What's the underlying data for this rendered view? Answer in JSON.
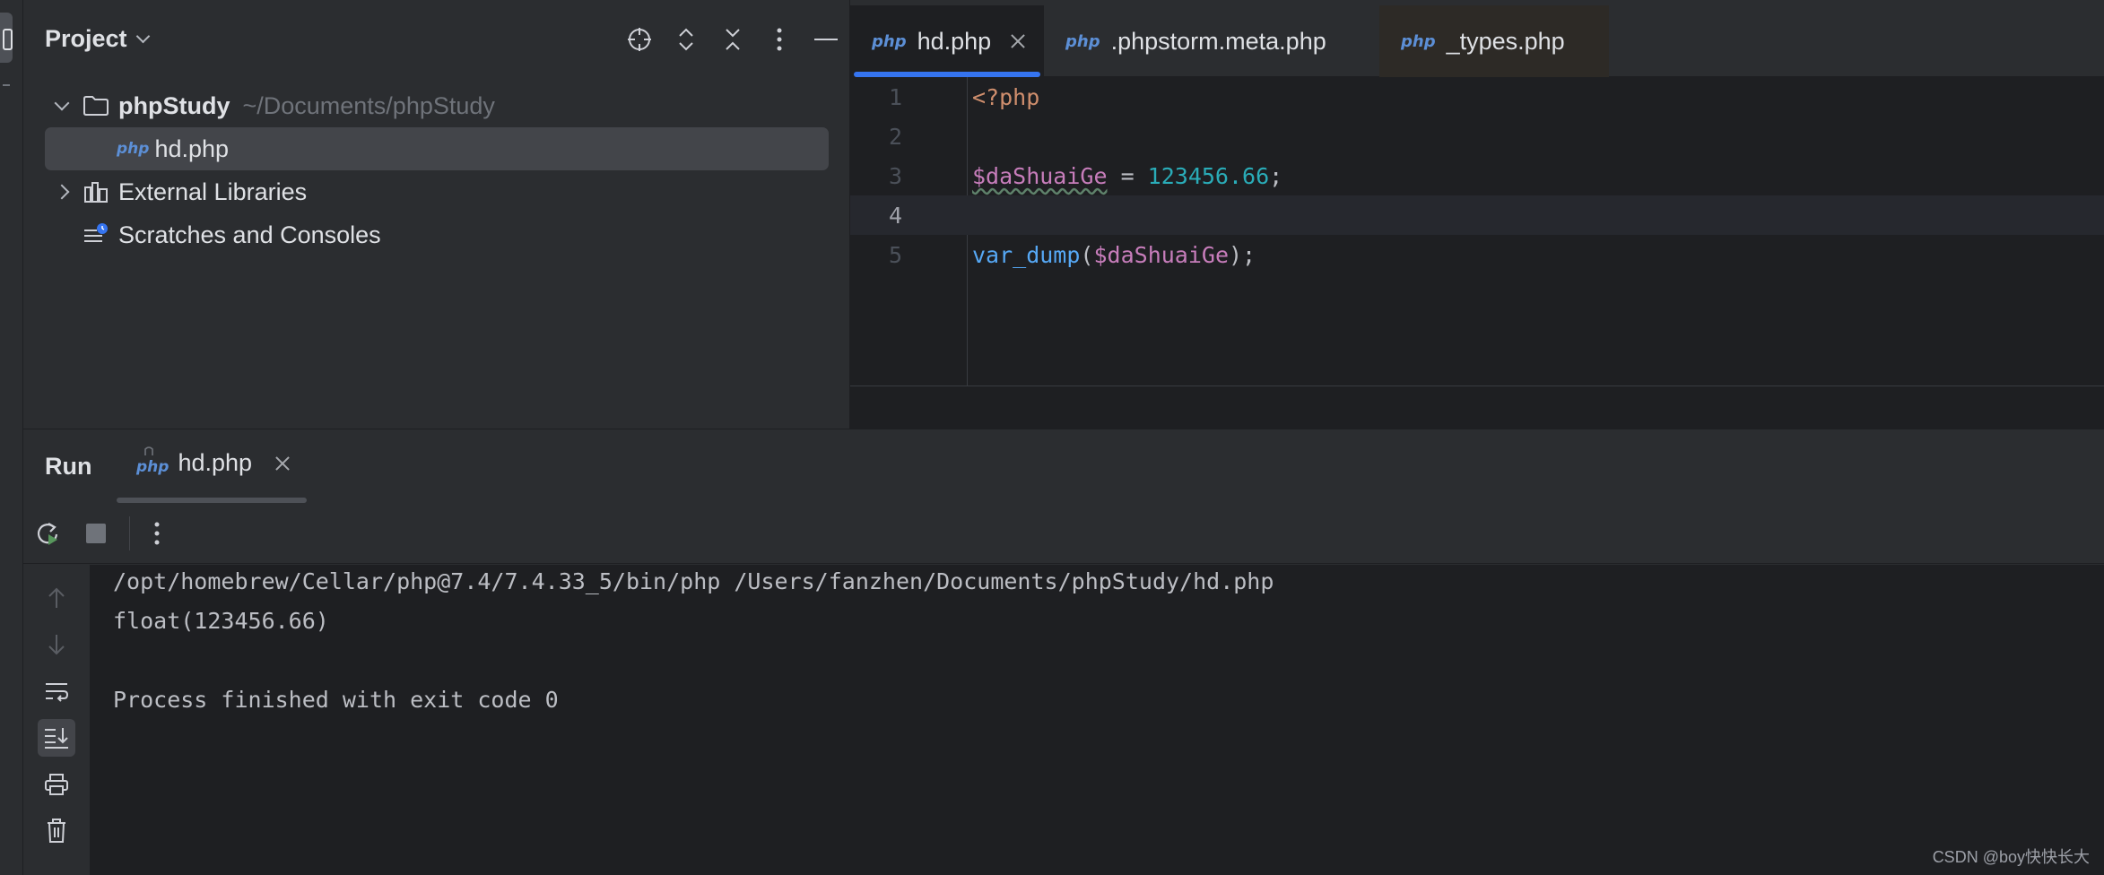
{
  "project_panel": {
    "title": "Project",
    "tree": {
      "root_name": "phpStudy",
      "root_path": "~/Documents/phpStudy",
      "file_icon_text": "php",
      "selected_file": "hd.php",
      "libraries": "External Libraries",
      "scratches": "Scratches and Consoles"
    }
  },
  "editor": {
    "tabs": [
      {
        "icon": "php",
        "label": "hd.php",
        "active": true
      },
      {
        "icon": "php",
        "label": ".phpstorm.meta.php"
      },
      {
        "icon": "php",
        "label": "_types.php"
      }
    ],
    "lines": [
      {
        "num": "1",
        "tag": "<?php"
      },
      {
        "num": "2"
      },
      {
        "num": "3",
        "var": "$daShuaiGe",
        "op": " = ",
        "number": "123456.66",
        "end": ";"
      },
      {
        "num": "4",
        "current": true
      },
      {
        "num": "5",
        "fn": "var_dump",
        "open": "(",
        "var": "$daShuaiGe",
        "close": ");"
      }
    ]
  },
  "run_panel": {
    "title": "Run",
    "tab_icon_text": "php",
    "tab_label": "hd.php",
    "output": [
      "/opt/homebrew/Cellar/php@7.4/7.4.33_5/bin/php /Users/fanzhen/Documents/phpStudy/hd.php",
      "float(123456.66)",
      "",
      "Process finished with exit code 0"
    ]
  },
  "watermark": "CSDN @boy快快长大",
  "colors": {
    "accent": "#3574f0",
    "keyword_tag": "#cf8e6d",
    "variable": "#c77dbb",
    "number": "#2aacb8",
    "function": "#56a8f5"
  }
}
